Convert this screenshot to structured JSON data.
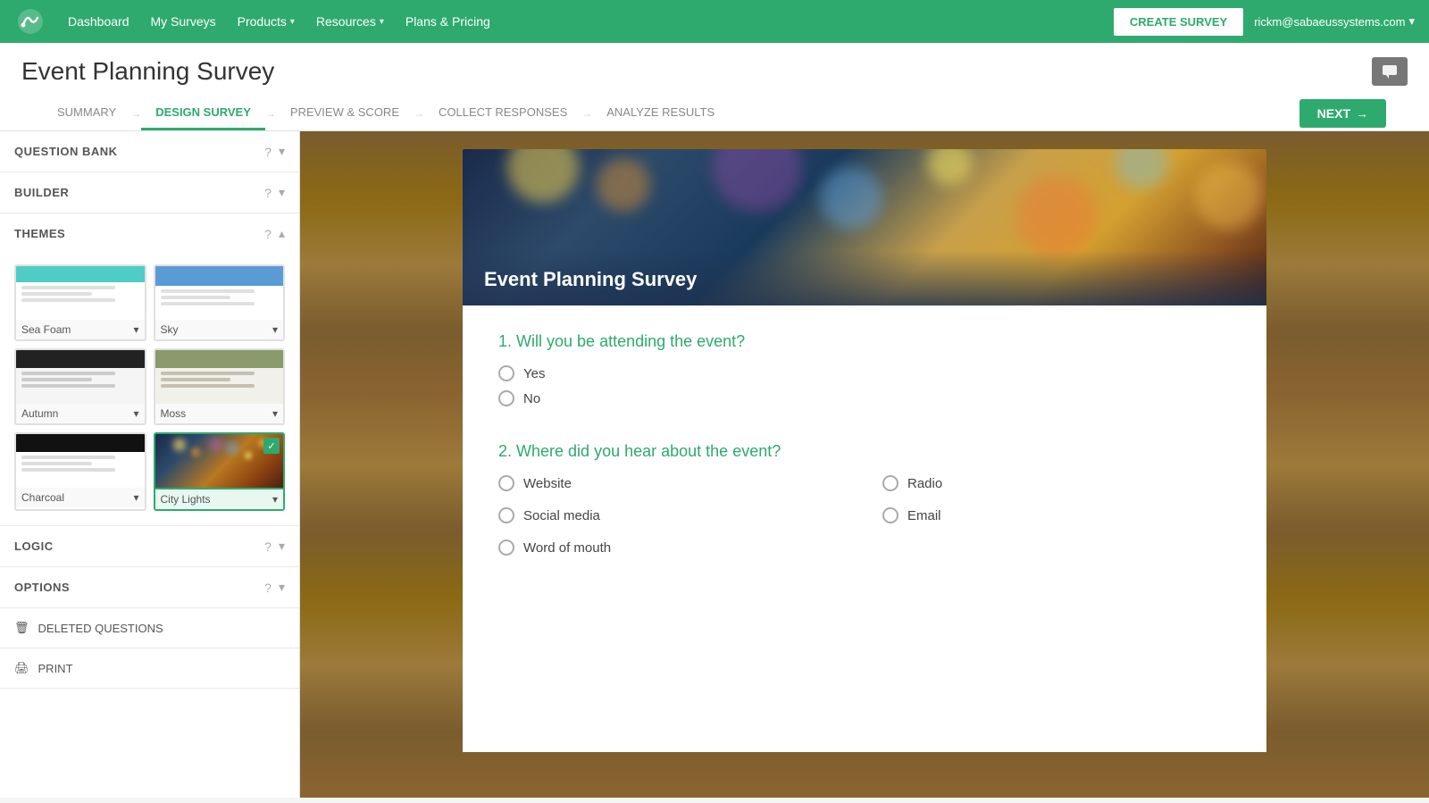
{
  "nav": {
    "logo_alt": "SurveyGizmo",
    "links": [
      {
        "label": "Dashboard",
        "has_dropdown": false
      },
      {
        "label": "My Surveys",
        "has_dropdown": false
      },
      {
        "label": "Products",
        "has_dropdown": true
      },
      {
        "label": "Resources",
        "has_dropdown": true
      },
      {
        "label": "Plans & Pricing",
        "has_dropdown": false
      }
    ],
    "create_survey": "CREATE SURVEY",
    "user_email": "rickm@sabaeussystems.com"
  },
  "page": {
    "title": "Event Planning Survey",
    "comment_icon": "💬"
  },
  "tabs": [
    {
      "label": "SUMMARY",
      "active": false
    },
    {
      "label": "DESIGN SURVEY",
      "active": true
    },
    {
      "label": "PREVIEW & SCORE",
      "active": false
    },
    {
      "label": "COLLECT RESPONSES",
      "active": false
    },
    {
      "label": "ANALYZE RESULTS",
      "active": false
    }
  ],
  "next_button": "NEXT",
  "sidebar": {
    "sections": [
      {
        "title": "QUESTION BANK",
        "expanded": false
      },
      {
        "title": "BUILDER",
        "expanded": false
      },
      {
        "title": "THEMES",
        "expanded": true
      },
      {
        "title": "LOGIC",
        "expanded": false
      },
      {
        "title": "OPTIONS",
        "expanded": false
      }
    ],
    "themes": [
      {
        "name": "Sea Foam",
        "type": "seafoam",
        "selected": false
      },
      {
        "name": "Sky",
        "type": "sky",
        "selected": false
      },
      {
        "name": "Autumn",
        "type": "autumn",
        "selected": false
      },
      {
        "name": "Moss",
        "type": "moss",
        "selected": false
      },
      {
        "name": "Charcoal",
        "type": "charcoal",
        "selected": false
      },
      {
        "name": "City Lights",
        "type": "citylights",
        "selected": true
      }
    ],
    "bottom_items": [
      {
        "icon": "🗑",
        "label": "DELETED QUESTIONS"
      },
      {
        "icon": "🖨",
        "label": "PRINT"
      }
    ]
  },
  "survey": {
    "title": "Event Planning Survey",
    "questions": [
      {
        "number": "1.",
        "text": "Will you be attending the event?",
        "type": "radio",
        "options": [
          {
            "label": "Yes"
          },
          {
            "label": "No"
          }
        ]
      },
      {
        "number": "2.",
        "text": "Where did you hear about the event?",
        "type": "radio_grid",
        "options": [
          {
            "label": "Website"
          },
          {
            "label": "Radio"
          },
          {
            "label": "Social media"
          },
          {
            "label": "Email"
          },
          {
            "label": "Word of mouth"
          }
        ]
      }
    ]
  }
}
